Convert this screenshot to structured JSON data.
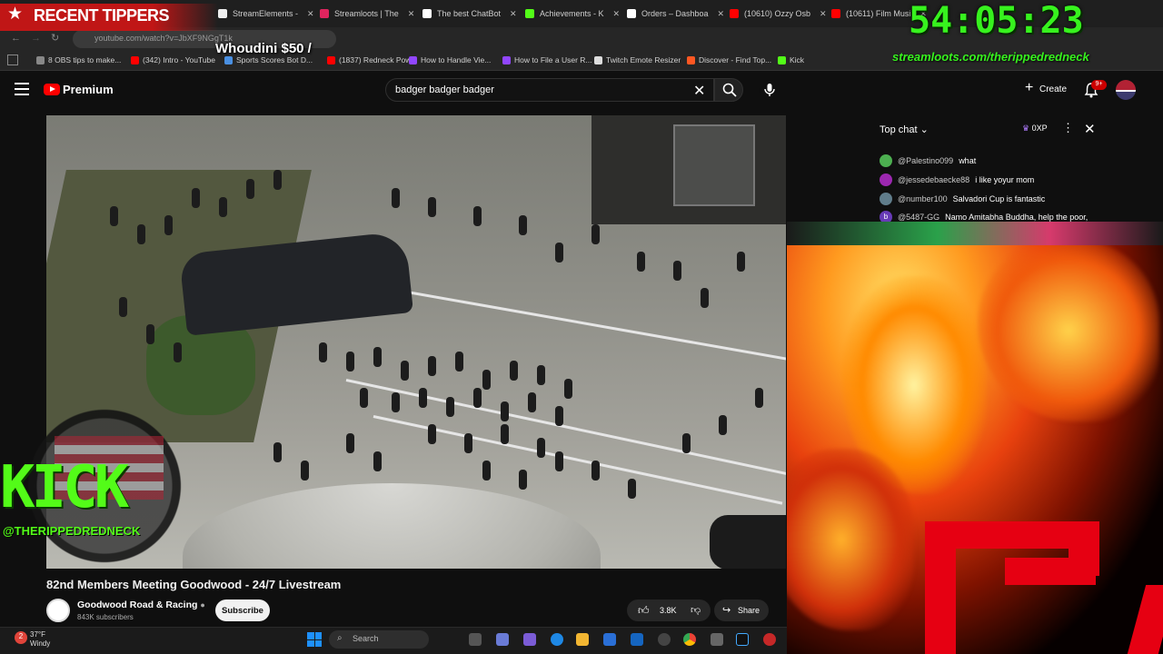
{
  "browser": {
    "tabs": [
      {
        "label": "StreamElements -",
        "color": "#eeeeee"
      },
      {
        "label": "Streamloots | The",
        "color": "#e0245e"
      },
      {
        "label": "The best ChatBot",
        "color": "#ffffff"
      },
      {
        "label": "Achievements - K",
        "color": "#53fc18"
      },
      {
        "label": "Orders – Dashboa",
        "color": "#ffffff"
      },
      {
        "label": "(10610) Ozzy Osb",
        "color": "#ff0000"
      },
      {
        "label": "(10611) Film Musi",
        "color": "#ff0000"
      }
    ],
    "url": "youtube.com/watch?v=JbXF9NGgT1k",
    "bookmarks": [
      {
        "label": "8 OBS tips to make...",
        "color": "#888888"
      },
      {
        "label": "(342) Intro - YouTube",
        "color": "#ff0000"
      },
      {
        "label": "Sports Scores Bot D...",
        "color": "#4a90e2"
      },
      {
        "label": "(1837) Redneck Pow...",
        "color": "#ff0000"
      },
      {
        "label": "How to Handle Vie...",
        "color": "#9146ff"
      },
      {
        "label": "How to File a User R...",
        "color": "#9146ff"
      },
      {
        "label": "Twitch Emote Resizer",
        "color": "#dddddd"
      },
      {
        "label": "Discover - Find Top...",
        "color": "#ff5722"
      },
      {
        "label": "Kick",
        "color": "#53fc18"
      }
    ]
  },
  "youtube": {
    "logo_text": "Premium",
    "search_value": "badger badger badger",
    "create_label": "Create",
    "notifications_badge": "9+"
  },
  "chat": {
    "title": "Top chat",
    "xp_label": "0XP",
    "messages": [
      {
        "author": "@Palestino099",
        "text": "what",
        "color": "#4caf50"
      },
      {
        "author": "@jessedebaecke88",
        "text": "i like yoyur mom",
        "color": "#9c27b0"
      },
      {
        "author": "@number100",
        "text": "Salvadori Cup is fantastic",
        "color": "#607d8b"
      },
      {
        "author": "@5487-GG",
        "text": "Namo Amitabha Buddha, help the poor,",
        "color": "#673ab7",
        "initial": "b"
      }
    ]
  },
  "video": {
    "title": "82nd Members Meeting Goodwood - 24/7 Livestream",
    "channel": "Goodwood Road & Racing",
    "subscribers": "843K subscribers",
    "subscribe_label": "Subscribe",
    "likes": "3.8K",
    "share_label": "Share"
  },
  "taskbar": {
    "temperature": "37°F",
    "condition": "Windy",
    "weather_badge": "2",
    "search_label": "Search"
  },
  "overlay": {
    "recent_tippers": "RECENT TIPPERS",
    "tipper": "Whoudini $50 /",
    "timer": "54:05:23",
    "streamloots_url": "streamloots.com/therippedredneck",
    "kick_logo": "KICK",
    "kick_handle": "@THERIPPEDREDNECK"
  },
  "colors": {
    "timer_green": "#37f21e",
    "kick_green": "#53fc18",
    "tipper_red": "#c01616",
    "youtube_red": "#ff0000"
  }
}
